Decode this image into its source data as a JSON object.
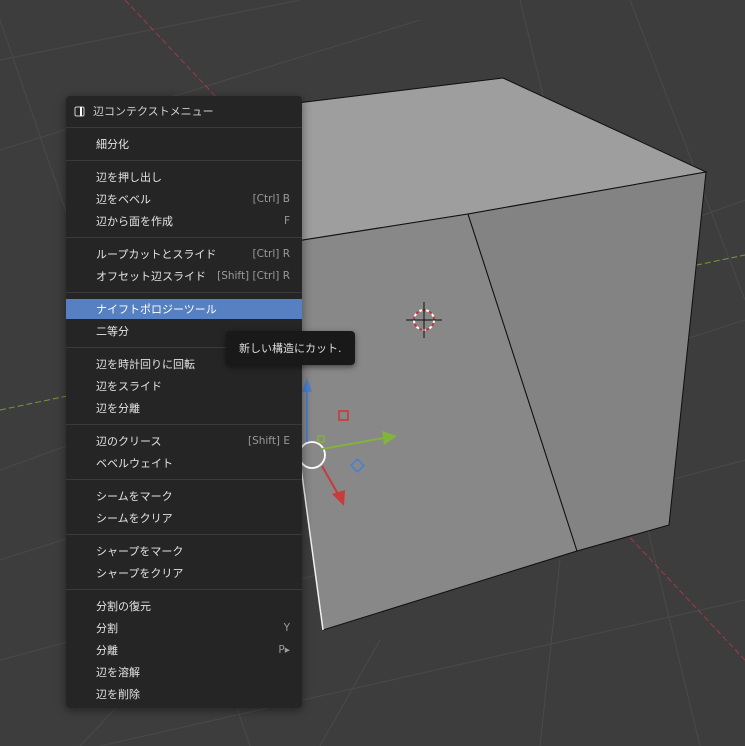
{
  "menu": {
    "title": "辺コンテクストメニュー",
    "items": [
      {
        "label": "細分化",
        "shortcut": ""
      },
      {
        "label": "辺を押し出し",
        "shortcut": ""
      },
      {
        "label": "辺をベベル",
        "shortcut": "[Ctrl] B"
      },
      {
        "label": "辺から面を作成",
        "shortcut": "F"
      },
      {
        "label": "ループカットとスライド",
        "shortcut": "[Ctrl] R"
      },
      {
        "label": "オフセット辺スライド",
        "shortcut": "[Shift] [Ctrl] R"
      },
      {
        "label": "ナイフトポロジーツール",
        "shortcut": "",
        "active": true
      },
      {
        "label": "二等分",
        "shortcut": ""
      },
      {
        "label": "辺を時計回りに回転",
        "shortcut": ""
      },
      {
        "label": "辺をスライド",
        "shortcut": ""
      },
      {
        "label": "辺を分離",
        "shortcut": ""
      },
      {
        "label": "辺のクリース",
        "shortcut": "[Shift] E"
      },
      {
        "label": "ベベルウェイト",
        "shortcut": ""
      },
      {
        "label": "シームをマーク",
        "shortcut": ""
      },
      {
        "label": "シームをクリア",
        "shortcut": ""
      },
      {
        "label": "シャープをマーク",
        "shortcut": ""
      },
      {
        "label": "シャープをクリア",
        "shortcut": ""
      },
      {
        "label": "分割の復元",
        "shortcut": ""
      },
      {
        "label": "分割",
        "shortcut": "Y"
      },
      {
        "label": "分離",
        "shortcut": "P▸"
      },
      {
        "label": "辺を溶解",
        "shortcut": ""
      },
      {
        "label": "辺を削除",
        "shortcut": ""
      }
    ]
  },
  "tooltip": {
    "text": "新しい構造にカット."
  },
  "colors": {
    "background": "#3d3d3d",
    "menu_bg": "#252525",
    "active": "#5680c2",
    "x_axis": "#b8383f",
    "y_axis": "#7fa83a",
    "z_axis": "#4a7fd0"
  }
}
